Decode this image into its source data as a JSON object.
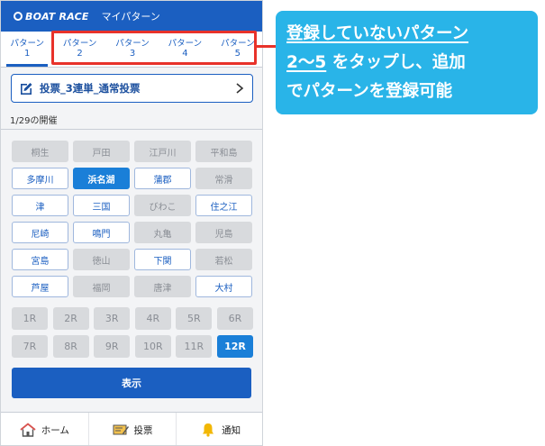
{
  "header": {
    "logo_text": "BOAT RACE",
    "title": "マイパターン"
  },
  "tabs": [
    {
      "label": "パターン",
      "num": "1",
      "active": true
    },
    {
      "label": "パターン",
      "num": "2",
      "active": false
    },
    {
      "label": "パターン",
      "num": "3",
      "active": false
    },
    {
      "label": "パターン",
      "num": "4",
      "active": false
    },
    {
      "label": "パターン",
      "num": "5",
      "active": false
    }
  ],
  "bet": {
    "label": "投票_3連単_通常投票",
    "icon": "edit-icon"
  },
  "date_label": "1/29の開催",
  "venues": [
    {
      "name": "桐生",
      "state": "off"
    },
    {
      "name": "戸田",
      "state": "off"
    },
    {
      "name": "江戸川",
      "state": "off"
    },
    {
      "name": "平和島",
      "state": "off"
    },
    {
      "name": "多摩川",
      "state": "on"
    },
    {
      "name": "浜名湖",
      "state": "sel"
    },
    {
      "name": "蒲郡",
      "state": "on"
    },
    {
      "name": "常滑",
      "state": "off"
    },
    {
      "name": "津",
      "state": "on"
    },
    {
      "name": "三国",
      "state": "on"
    },
    {
      "name": "びわこ",
      "state": "off"
    },
    {
      "name": "住之江",
      "state": "on"
    },
    {
      "name": "尼崎",
      "state": "on"
    },
    {
      "name": "鳴門",
      "state": "on"
    },
    {
      "name": "丸亀",
      "state": "off"
    },
    {
      "name": "児島",
      "state": "off"
    },
    {
      "name": "宮島",
      "state": "on"
    },
    {
      "name": "徳山",
      "state": "off"
    },
    {
      "name": "下関",
      "state": "on"
    },
    {
      "name": "若松",
      "state": "off"
    },
    {
      "name": "芦屋",
      "state": "on"
    },
    {
      "name": "福岡",
      "state": "off"
    },
    {
      "name": "唐津",
      "state": "off"
    },
    {
      "name": "大村",
      "state": "on"
    }
  ],
  "races": [
    {
      "name": "1R",
      "state": "off"
    },
    {
      "name": "2R",
      "state": "off"
    },
    {
      "name": "3R",
      "state": "off"
    },
    {
      "name": "4R",
      "state": "off"
    },
    {
      "name": "5R",
      "state": "off"
    },
    {
      "name": "6R",
      "state": "off"
    },
    {
      "name": "7R",
      "state": "off"
    },
    {
      "name": "8R",
      "state": "off"
    },
    {
      "name": "9R",
      "state": "off"
    },
    {
      "name": "10R",
      "state": "off"
    },
    {
      "name": "11R",
      "state": "off"
    },
    {
      "name": "12R",
      "state": "sel"
    }
  ],
  "show_button": "表示",
  "footer": {
    "home": "ホーム",
    "vote": "投票",
    "notice": "通知"
  },
  "callout": {
    "line1": "登録していないパターン",
    "line2": "2～5 をタップし、追加",
    "line3": "でパターンを登録可能"
  },
  "colors": {
    "brand_blue": "#1b5fc1",
    "selected_blue": "#1a7fd8",
    "highlight_red": "#e8322a",
    "callout_cyan": "#29b4e8"
  }
}
